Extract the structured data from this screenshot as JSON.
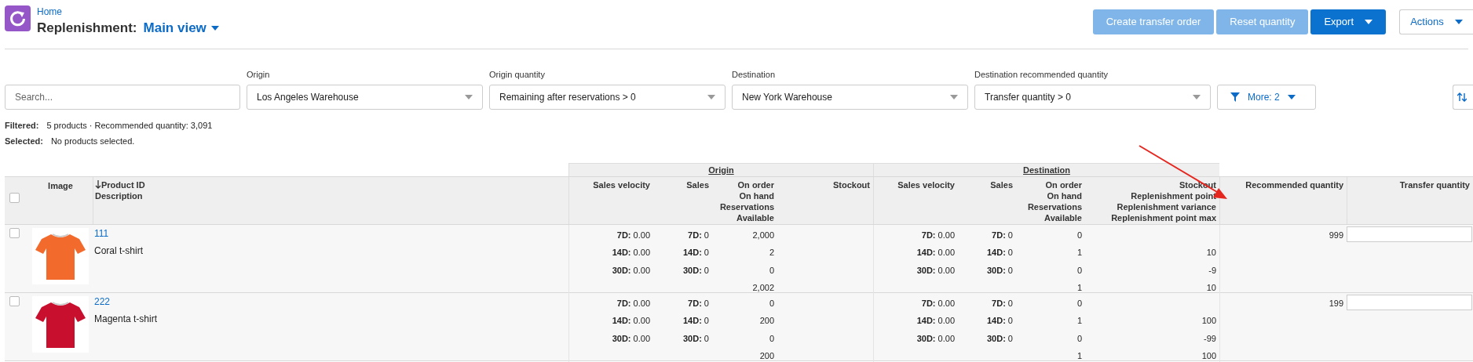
{
  "header": {
    "breadcrumb": "Home",
    "title": "Replenishment:",
    "view": "Main view"
  },
  "buttons": [
    {
      "label": "Create transfer order",
      "kind": "primary",
      "disabled": true,
      "caret": false
    },
    {
      "label": "Reset quantity",
      "kind": "primary",
      "disabled": true,
      "caret": false
    },
    {
      "label": "Export",
      "kind": "primary",
      "disabled": false,
      "caret": true
    },
    {
      "label": "Actions",
      "kind": "outline",
      "disabled": false,
      "caret": true
    }
  ],
  "filters": {
    "search": {
      "placeholder": "Search..."
    },
    "dropdowns": [
      {
        "label": "Origin",
        "value": "Los Angeles Warehouse"
      },
      {
        "label": "Origin quantity",
        "value": "Remaining after reservations > 0"
      },
      {
        "label": "Destination",
        "value": "New York Warehouse"
      },
      {
        "label": "Destination recommended quantity",
        "value": "Transfer quantity > 0"
      }
    ],
    "more": {
      "label": "More: 2"
    }
  },
  "summary": [
    {
      "label": "Filtered:",
      "text": "5 products · Recommended quantity: 3,091"
    },
    {
      "label": "Selected:",
      "text": "No products selected."
    }
  ],
  "table": {
    "select_all": {
      "checked": false
    },
    "groups": [
      "Origin",
      "Destination"
    ],
    "columns": {
      "image": "Image",
      "product": [
        "Product ID",
        "Description"
      ],
      "sorted": true,
      "origin": [
        [
          "Sales velocity"
        ],
        [
          "Sales"
        ],
        [
          "On order",
          "On hand",
          "Reservations",
          "Available"
        ],
        [
          "Stockout"
        ]
      ],
      "destination": [
        [
          "Sales velocity"
        ],
        [
          "Sales"
        ],
        [
          "On order",
          "On hand",
          "Reservations",
          "Available"
        ],
        [
          "Stockout",
          "Replenishment point",
          "Replenishment variance",
          "Replenishment point max"
        ]
      ],
      "recommended": "Recommended quantity",
      "transfer": "Transfer quantity"
    },
    "rows": [
      {
        "checked": false,
        "id": "111",
        "description": "Coral t-shirt",
        "origin": {
          "velocity": [
            "**7D:** 0.00",
            "**14D:** 0.00",
            "**30D:** 0.00"
          ],
          "sales": [
            "**7D:** 0",
            "**14D:** 0",
            "**30D:** 0"
          ],
          "stock": [
            "2,000",
            "2",
            "0",
            "2,002"
          ]
        },
        "destination": {
          "velocity": [
            "**7D:** 0.00",
            "**14D:** 0.00",
            "**30D:** 0.00"
          ],
          "sales": [
            "**7D:** 0",
            "**14D:** 0",
            "**30D:** 0"
          ],
          "stock": [
            "0",
            "1",
            "0",
            "1"
          ],
          "replenishment": [
            "10",
            "-9",
            "10"
          ]
        },
        "recommended": "999"
      },
      {
        "checked": false,
        "id": "222",
        "description": "Magenta t-shirt",
        "origin": {
          "velocity": [
            "**7D:** 0.00",
            "**14D:** 0.00",
            "**30D:** 0.00"
          ],
          "sales": [
            "**7D:** 0",
            "**14D:** 0",
            "**30D:** 0"
          ],
          "stock": [
            "0",
            "200",
            "0",
            "200"
          ]
        },
        "destination": {
          "velocity": [
            "**7D:** 0.00",
            "**14D:** 0.00",
            "**30D:** 0.00"
          ],
          "sales": [
            "**7D:** 0",
            "**14D:** 0",
            "**30D:** 0"
          ],
          "stock": [
            "0",
            "1",
            "0",
            "1"
          ],
          "replenishment": [
            "100",
            "-99",
            "100"
          ]
        },
        "recommended": "199"
      }
    ]
  }
}
